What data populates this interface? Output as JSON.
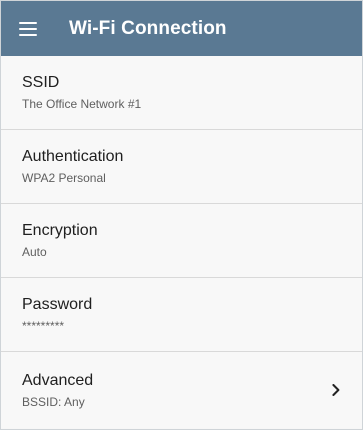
{
  "header": {
    "title": "Wi-Fi Connection",
    "menu_icon": "hamburger-menu-icon"
  },
  "settings": [
    {
      "label": "SSID",
      "value": "The Office Network #1"
    },
    {
      "label": "Authentication",
      "value": "WPA2 Personal"
    },
    {
      "label": "Encryption",
      "value": "Auto"
    },
    {
      "label": "Password",
      "value": "*********"
    },
    {
      "label": "Advanced",
      "value": "BSSID:  Any",
      "icon": "chevron-right-icon"
    }
  ],
  "colors": {
    "appbar": "#5a7993",
    "background": "#f8f8f8",
    "divider": "#d9d9d9"
  }
}
